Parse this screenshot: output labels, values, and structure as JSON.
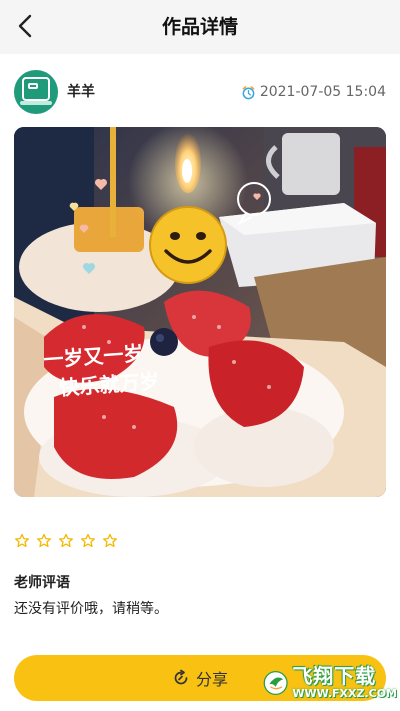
{
  "header": {
    "title": "作品详情"
  },
  "author": {
    "name": "羊羊",
    "time": "2021-07-05 15:04"
  },
  "photo": {
    "caption_line1": "一岁又一岁",
    "caption_line2": "快乐就万岁"
  },
  "rating": {
    "stars": 5,
    "filled": 0,
    "color": "#f5b800"
  },
  "comment": {
    "title": "老师评语",
    "text": "还没有评价哦，请稍等。"
  },
  "share": {
    "label": "分享"
  },
  "watermark": {
    "main": "飞翔下载",
    "url": "WWW.FXXZ.COM"
  },
  "colors": {
    "accent": "#f9c212",
    "avatar": "#1f9a7a"
  }
}
